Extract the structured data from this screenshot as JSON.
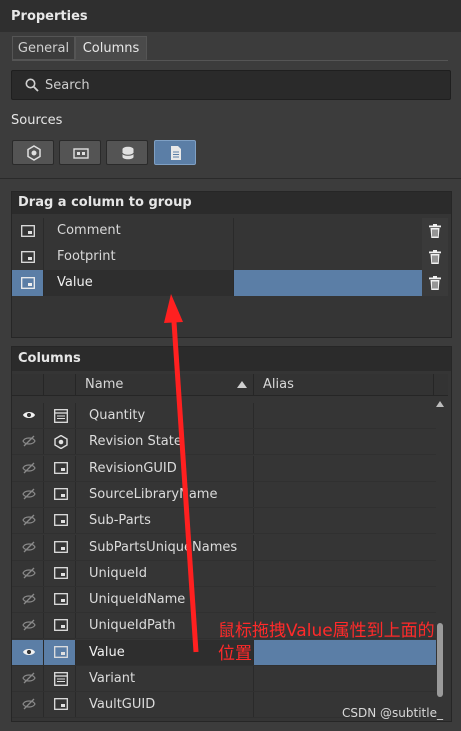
{
  "panel": {
    "title": "Properties"
  },
  "tabs": [
    {
      "label": "General"
    },
    {
      "label": "Columns"
    }
  ],
  "search": {
    "placeholder": "Search"
  },
  "sources": {
    "label": "Sources"
  },
  "group": {
    "header": "Drag a column to group",
    "rows": [
      {
        "name": "Comment"
      },
      {
        "name": "Footprint"
      },
      {
        "name": "Value"
      }
    ]
  },
  "columns": {
    "header": "Columns",
    "name_header": "Name",
    "alias_header": "Alias",
    "rows": [
      {
        "name": "Quantity",
        "visible": true,
        "icon": "table-icon"
      },
      {
        "name": "Revision State",
        "visible": false,
        "icon": "component-icon"
      },
      {
        "name": "RevisionGUID",
        "visible": false,
        "icon": "param-icon"
      },
      {
        "name": "SourceLibraryName",
        "visible": false,
        "icon": "param-icon"
      },
      {
        "name": "Sub-Parts",
        "visible": false,
        "icon": "param-icon"
      },
      {
        "name": "SubPartsUniqueNames",
        "visible": false,
        "icon": "param-icon"
      },
      {
        "name": "UniqueId",
        "visible": false,
        "icon": "param-icon"
      },
      {
        "name": "UniqueIdName",
        "visible": false,
        "icon": "param-icon"
      },
      {
        "name": "UniqueIdPath",
        "visible": false,
        "icon": "param-icon"
      },
      {
        "name": "Value",
        "visible": true,
        "icon": "param-icon"
      },
      {
        "name": "Variant",
        "visible": false,
        "icon": "table-icon"
      },
      {
        "name": "VaultGUID",
        "visible": false,
        "icon": "param-icon"
      }
    ]
  },
  "annotation": {
    "text": "鼠标拖拽Value属性到上面的位置"
  },
  "watermark": {
    "text": "CSDN @subtitle_"
  },
  "colors": {
    "accent": "#5b7ea6",
    "annotation": "#ff2a2a"
  }
}
